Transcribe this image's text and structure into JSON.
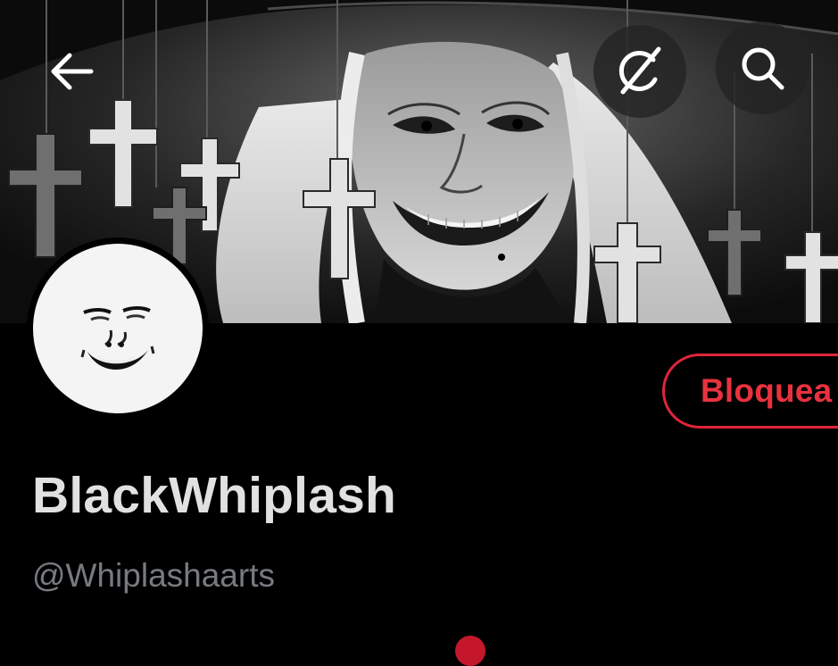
{
  "header": {
    "back_icon": "arrow-left-icon",
    "grok_icon": "grok-icon",
    "search_icon": "search-icon"
  },
  "profile": {
    "display_name": "BlackWhiplash",
    "handle": "@Whiplashaarts",
    "block_button_label": "Bloquea"
  },
  "colors": {
    "background": "#000000",
    "block_red": "#e8323e",
    "name_text": "#e1e1e1",
    "handle_text": "#777b80"
  }
}
